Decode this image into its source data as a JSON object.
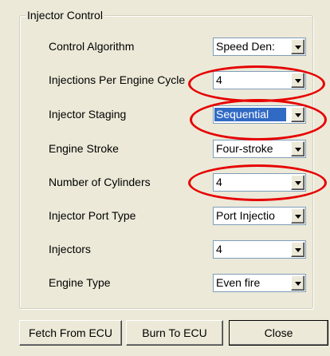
{
  "group": {
    "title": "Injector Control"
  },
  "fields": [
    {
      "label": "Control Algorithm",
      "value": "Speed Den:",
      "selected": false
    },
    {
      "label": "Injections Per Engine Cycle",
      "value": "4",
      "selected": false
    },
    {
      "label": "Injector Staging",
      "value": "Sequential",
      "selected": true
    },
    {
      "label": "Engine Stroke",
      "value": "Four-stroke",
      "selected": false
    },
    {
      "label": "Number of Cylinders",
      "value": "4",
      "selected": false
    },
    {
      "label": "Injector Port Type",
      "value": "Port Injectio",
      "selected": false
    },
    {
      "label": "Injectors",
      "value": "4",
      "selected": false
    },
    {
      "label": "Engine Type",
      "value": "Even fire",
      "selected": false
    }
  ],
  "buttons": {
    "fetch": "Fetch From ECU",
    "burn": "Burn To ECU",
    "close": "Close"
  },
  "annotation_color": "#e60000"
}
